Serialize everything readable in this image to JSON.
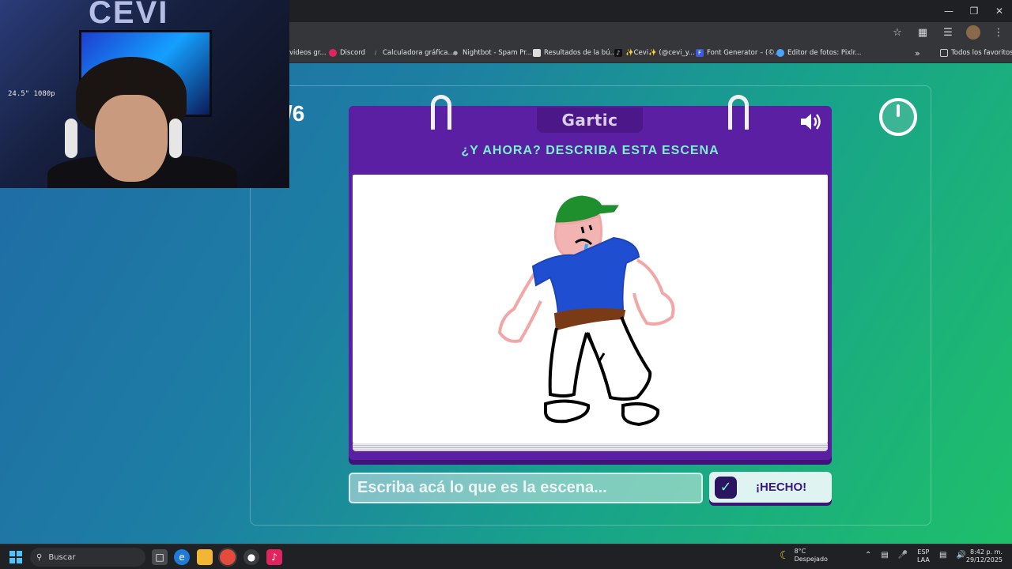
{
  "browser": {
    "bookmarks": [
      {
        "label": "videos gr...",
        "icon": "bookmark-icon",
        "color": "#f1c232"
      },
      {
        "label": "Discord",
        "icon": "discord-icon",
        "color": "#e0245e"
      },
      {
        "label": "Calculadora gráfica...",
        "icon": "desmos-icon",
        "color": "#6aa84f"
      },
      {
        "label": "Nightbot - Spam Pr...",
        "icon": "nightbot-icon",
        "color": "#555555"
      },
      {
        "label": "Resultados de la bú...",
        "icon": "page-icon",
        "color": "#dddddd"
      },
      {
        "label": "✨Cevi✨ (@cevi_y...",
        "icon": "tiktok-icon",
        "color": "#111111"
      },
      {
        "label": "Font Generator – (©...",
        "icon": "font-icon",
        "color": "#3b5bdb"
      },
      {
        "label": "Editor de fotos: Pixlr...",
        "icon": "pixlr-icon",
        "color": "#4aa3ff"
      }
    ],
    "all_bookmarks_label": "Todos los favoritos"
  },
  "game": {
    "round_counter": "/6",
    "logo": "Gartic",
    "prompt_title": "¿Y AHORA? DESCRIBA ESTA ESCENA",
    "answer_placeholder": "Escriba acá lo que es la escena...",
    "done_label": "¡HECHO!"
  },
  "webcam": {
    "brand": "CEVI",
    "sticker": "24.5\" 1080p"
  },
  "taskbar": {
    "search_label": "Buscar",
    "weather_temp": "8°C",
    "weather_desc": "Despejado",
    "lang_top": "ESP",
    "lang_bottom": "LAA",
    "time": "8:42 p. m.",
    "date": "29/12/2025"
  },
  "colors": {
    "card": "#5a1fa3",
    "title": "#7cf0d0",
    "accent_bg_start": "#1f6aa6",
    "accent_bg_end": "#1fbf6a"
  }
}
